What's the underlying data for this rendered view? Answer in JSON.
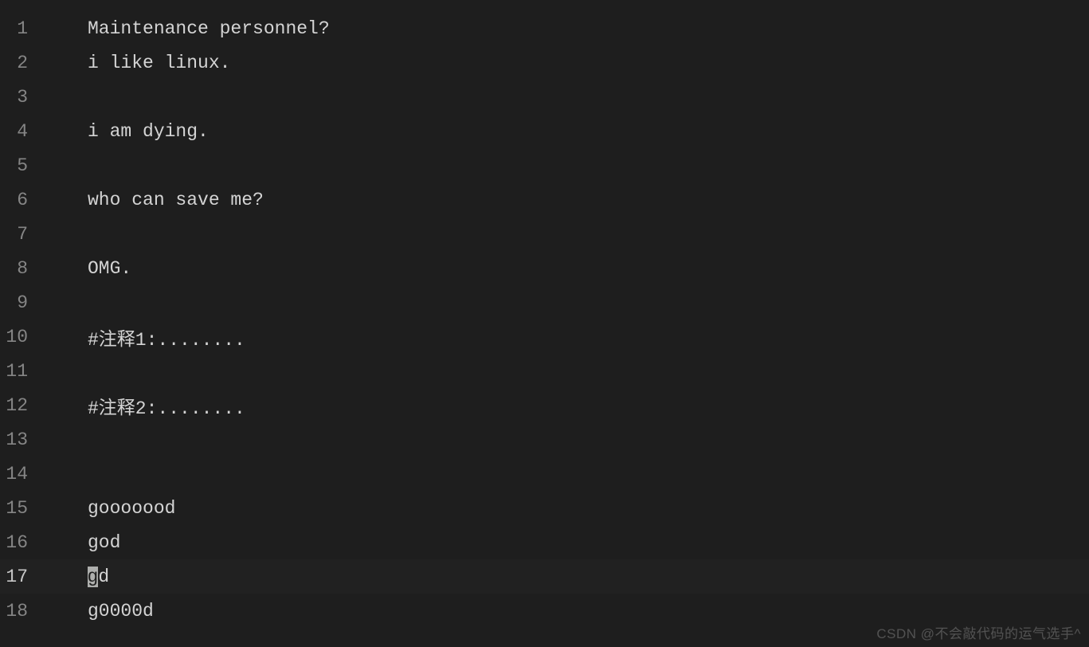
{
  "lines": [
    {
      "n": 1,
      "text": "Maintenance personnel?"
    },
    {
      "n": 2,
      "text": "i like linux."
    },
    {
      "n": 3,
      "text": ""
    },
    {
      "n": 4,
      "text": "i am dying."
    },
    {
      "n": 5,
      "text": ""
    },
    {
      "n": 6,
      "text": "who can save me?"
    },
    {
      "n": 7,
      "text": ""
    },
    {
      "n": 8,
      "text": "OMG."
    },
    {
      "n": 9,
      "text": ""
    },
    {
      "n": 10,
      "text": "#注释1:........"
    },
    {
      "n": 11,
      "text": ""
    },
    {
      "n": 12,
      "text": "#注释2:........"
    },
    {
      "n": 13,
      "text": ""
    },
    {
      "n": 14,
      "text": ""
    },
    {
      "n": 15,
      "text": "gooooood"
    },
    {
      "n": 16,
      "text": "god"
    },
    {
      "n": 17,
      "text": "gd"
    },
    {
      "n": 18,
      "text": "g0000d"
    }
  ],
  "cursor": {
    "line": 17,
    "col": 0
  },
  "watermark": "CSDN @不会敲代码的运气选手^"
}
